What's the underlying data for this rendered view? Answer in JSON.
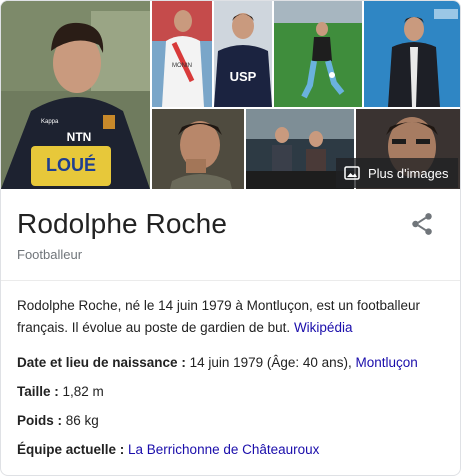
{
  "entity": {
    "name": "Rodolphe Roche",
    "type": "Footballeur"
  },
  "images": {
    "more_label": "Plus d'images"
  },
  "description": {
    "text": "Rodolphe Roche, né le 14 juin 1979 à Montluçon, est un footballeur français. Il évolue au poste de gardien de but. ",
    "source_link": "Wikipédia"
  },
  "facts": [
    {
      "label": "Date et lieu de naissance : ",
      "value": "14 juin 1979 (Âge: 40 ans), ",
      "link": "Montluçon"
    },
    {
      "label": "Taille : ",
      "value": "1,82 m",
      "link": ""
    },
    {
      "label": "Poids : ",
      "value": "86 kg",
      "link": ""
    },
    {
      "label": "Équipe actuelle : ",
      "value": "",
      "link": "La Berrichonne de Châteauroux"
    }
  ],
  "colors": {
    "link": "#1a0dab",
    "muted": "#70757a",
    "divider": "#ebebeb"
  }
}
